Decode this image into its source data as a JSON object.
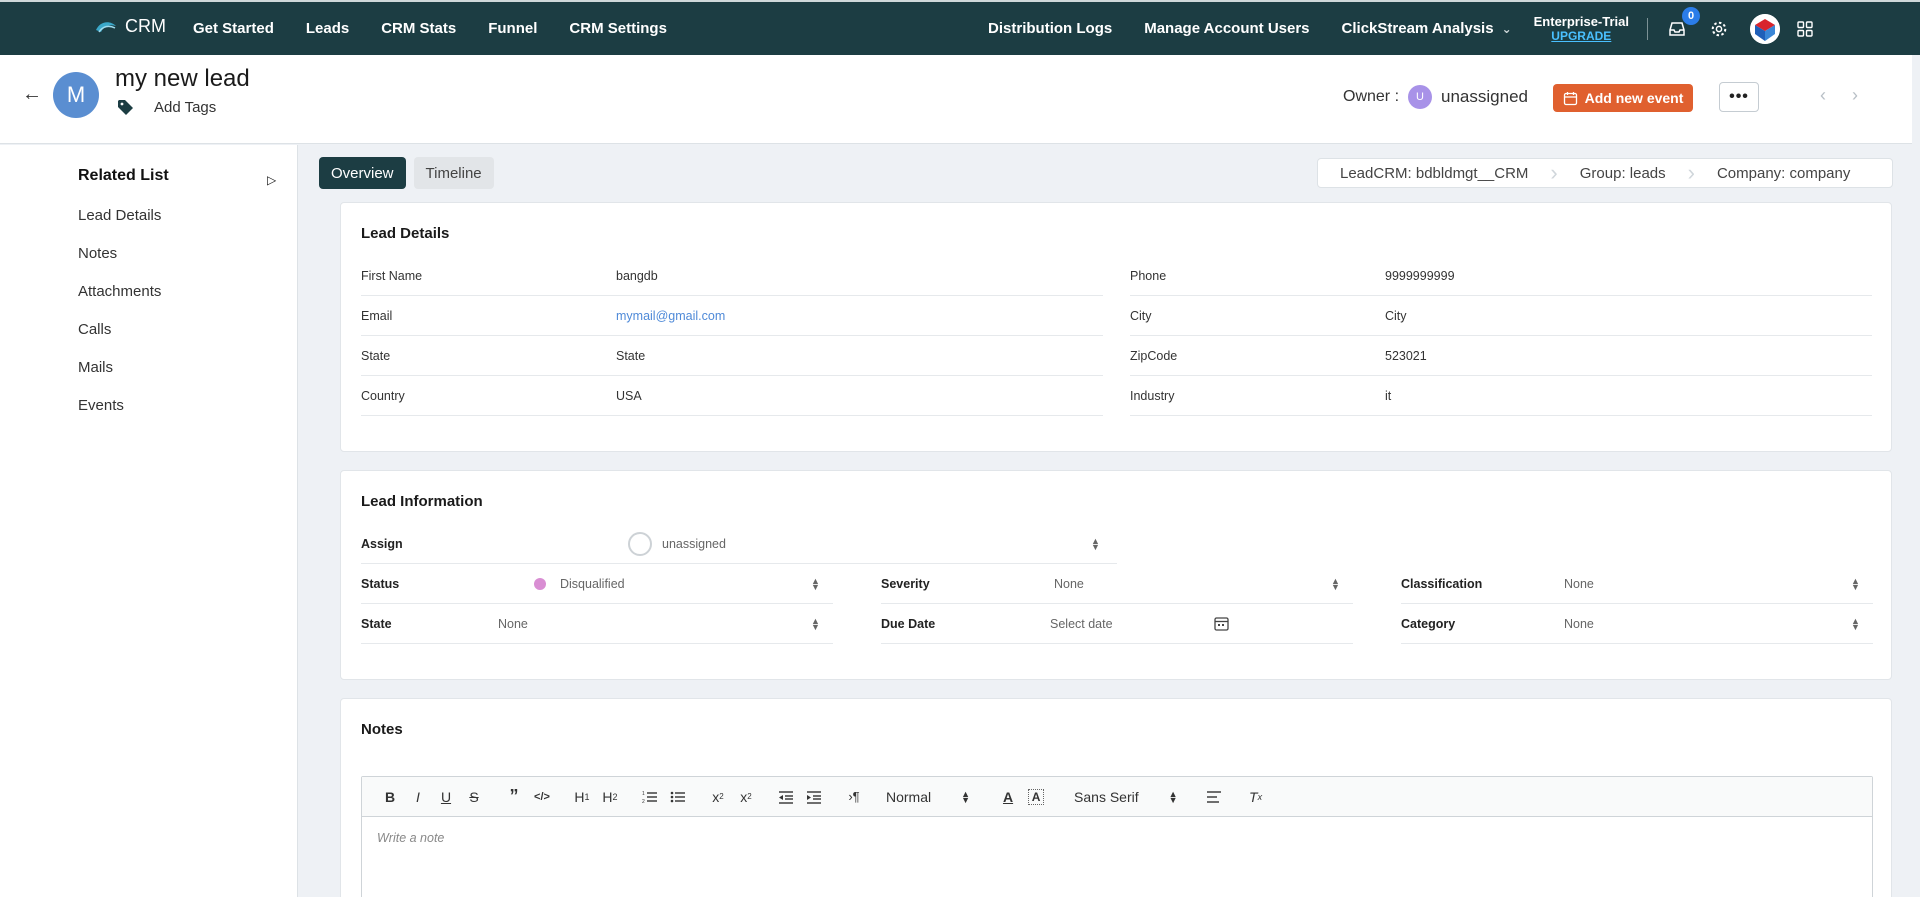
{
  "nav": {
    "brand": "CRM",
    "links": [
      "Get Started",
      "Leads",
      "CRM Stats",
      "Funnel",
      "CRM Settings"
    ],
    "right_links": [
      "Distribution Logs",
      "Manage Account Users"
    ],
    "clickstream": "ClickStream Analysis",
    "plan": "Enterprise-Trial",
    "upgrade": "UPGRADE",
    "inbox_count": "0",
    "accent": "#1c3d43"
  },
  "header": {
    "avatar_letter": "M",
    "title": "my new lead",
    "add_tags": "Add Tags",
    "owner_label": "Owner :",
    "owner_initial": "U",
    "owner_value": "unassigned",
    "add_event": "Add new event",
    "more": "•••"
  },
  "sidebar": {
    "title": "Related List",
    "items": [
      "Lead Details",
      "Notes",
      "Attachments",
      "Calls",
      "Mails",
      "Events"
    ]
  },
  "tabs": {
    "overview": "Overview",
    "timeline": "Timeline"
  },
  "breadcrumbs": [
    "LeadCRM: bdbldmgt__CRM",
    "Group: leads",
    "Company: company"
  ],
  "lead_details": {
    "title": "Lead Details",
    "left": [
      {
        "k": "First Name",
        "v": "bangdb"
      },
      {
        "k": "Email",
        "v": "mymail@gmail.com"
      },
      {
        "k": "State",
        "v": "State"
      },
      {
        "k": "Country",
        "v": "USA"
      }
    ],
    "right": [
      {
        "k": "Phone",
        "v": "9999999999"
      },
      {
        "k": "City",
        "v": "City"
      },
      {
        "k": "ZipCode",
        "v": "523021"
      },
      {
        "k": "Industry",
        "v": "it"
      }
    ]
  },
  "lead_info": {
    "title": "Lead Information",
    "assign_label": "Assign",
    "assign_value": "unassigned",
    "status_label": "Status",
    "status_value": "Disqualified",
    "severity_label": "Severity",
    "severity_value": "None",
    "classification_label": "Classification",
    "classification_value": "None",
    "state_label": "State",
    "state_value": "None",
    "due_label": "Due Date",
    "due_placeholder": "Select date",
    "category_label": "Category",
    "category_value": "None"
  },
  "notes": {
    "title": "Notes",
    "size_select": "Normal",
    "font_select": "Sans Serif",
    "placeholder": "Write a note"
  }
}
